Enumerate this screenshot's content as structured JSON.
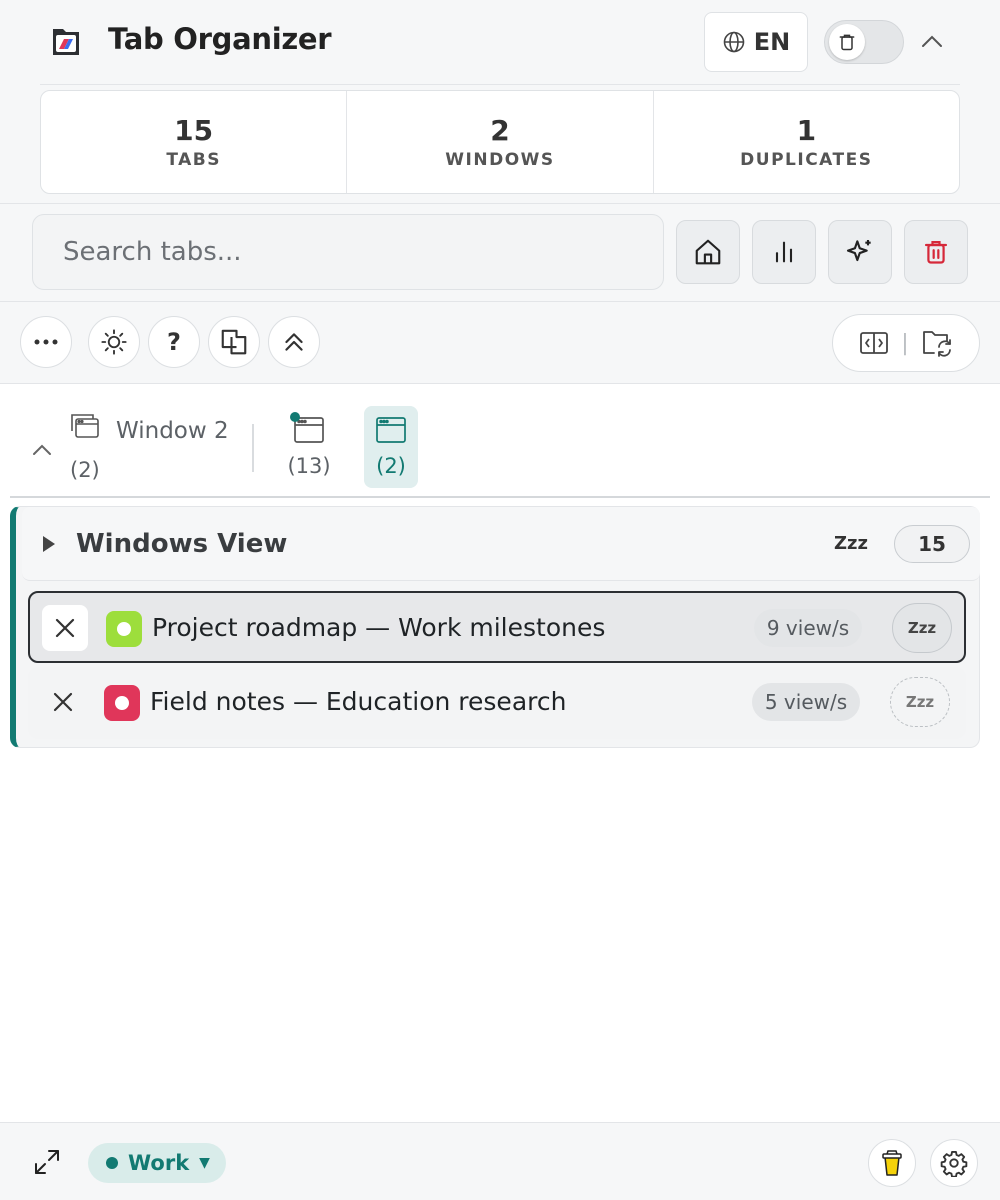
{
  "app": {
    "title": "Tab Organizer",
    "icon": "tab-organizer-logo",
    "language": "EN"
  },
  "stats": [
    {
      "value": "15",
      "label": "TABS"
    },
    {
      "value": "2",
      "label": "WINDOWS"
    },
    {
      "value": "1",
      "label": "DUPLICATES"
    }
  ],
  "search": {
    "placeholder": "Search tabs...",
    "value": ""
  },
  "toolbar": {
    "icons": [
      "home-icon",
      "stats-icon",
      "sparkles-icon",
      "trash-icon"
    ],
    "actions": [
      "more-icon",
      "theme-sun-icon",
      "help-icon",
      "duplicate-icon",
      "collapse-all-icon"
    ],
    "help_label": "?",
    "pill_divider": "|"
  },
  "windows": {
    "current_label": "Window 2",
    "current_count": "(2)",
    "tabs": [
      {
        "count": "(13)",
        "active": false,
        "indicator": true
      },
      {
        "count": "(2)",
        "active": true,
        "indicator": false
      }
    ]
  },
  "group": {
    "title": "Windows View",
    "snooze_label": "Zzz",
    "count": "15",
    "accent": "#127a72",
    "tabs": [
      {
        "title": "Project roadmap — Work milestones",
        "views": "9 view/s",
        "snooze": "Zzz",
        "favicon_color": "#9dde3c",
        "selected": true
      },
      {
        "title": "Field notes — Education research",
        "views": "5 view/s",
        "snooze": "Zzz",
        "favicon_color": "#e0365a",
        "selected": false
      }
    ]
  },
  "footer": {
    "profile": "Work",
    "caret": "▼",
    "profile_color": "#127a72"
  }
}
